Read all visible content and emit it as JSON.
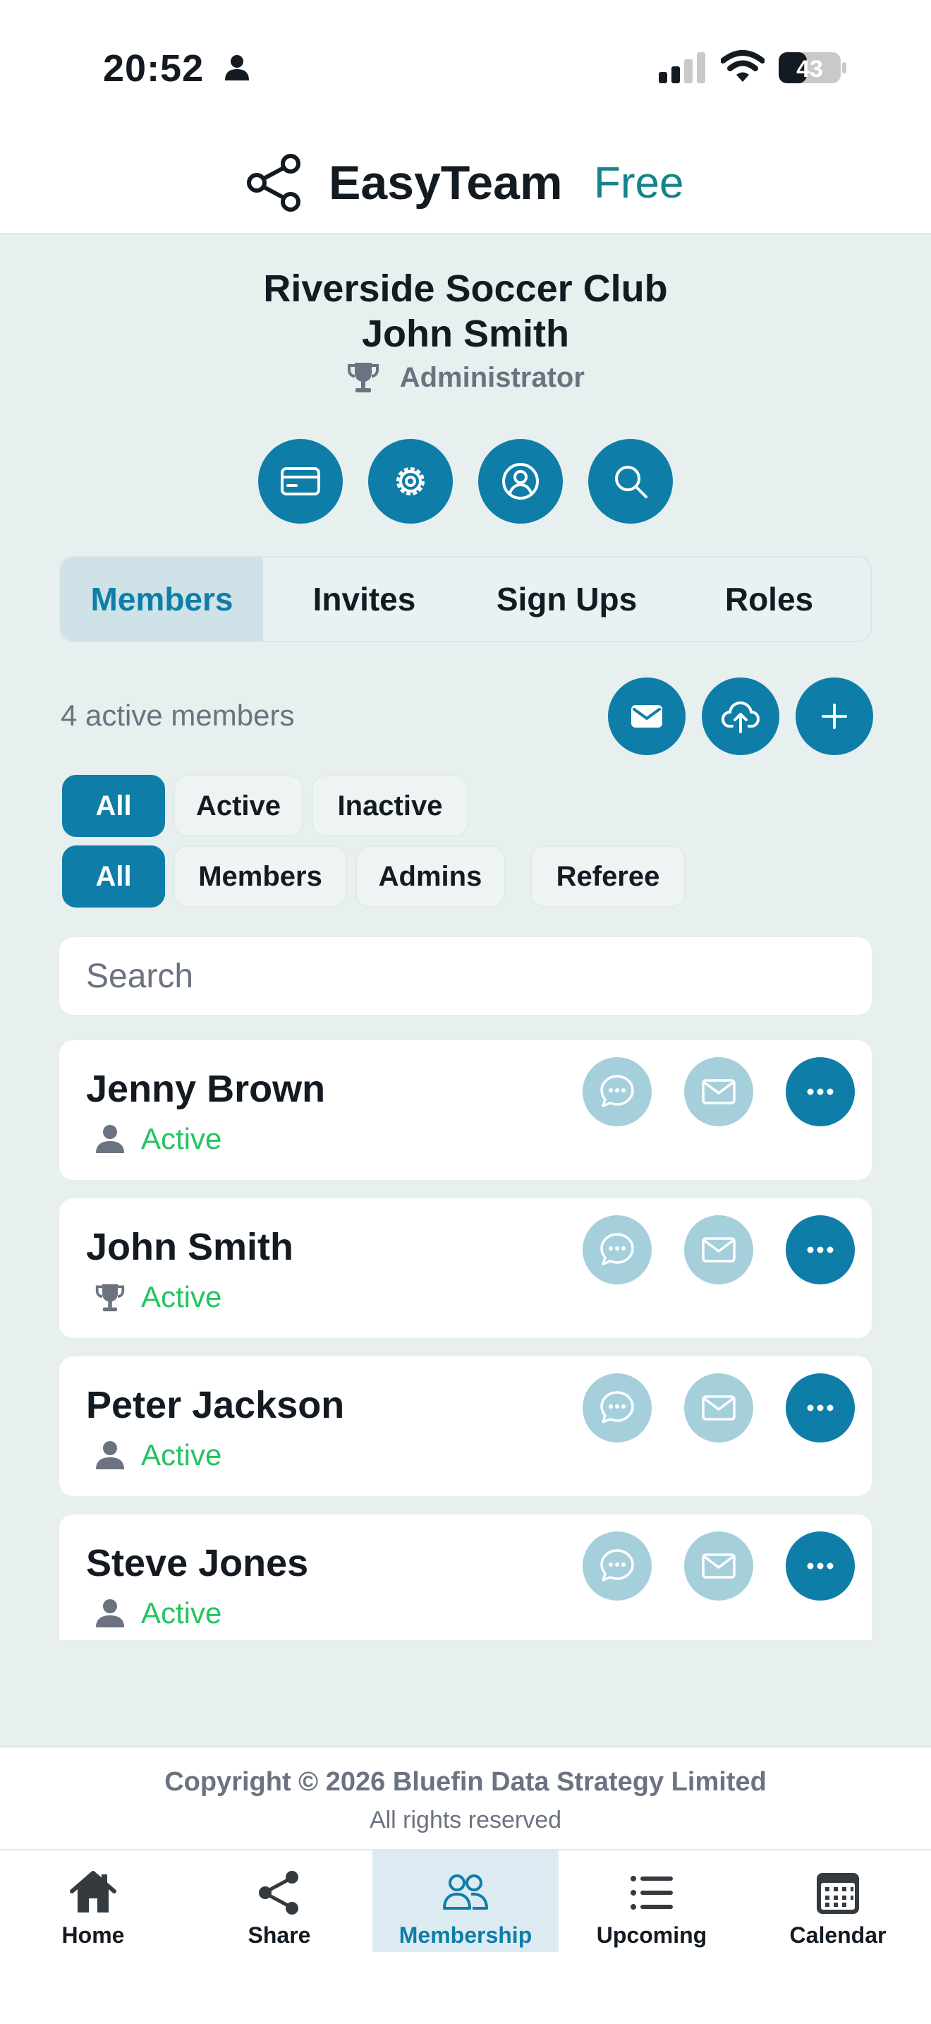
{
  "status_bar": {
    "time": "20:52",
    "battery": "43"
  },
  "header": {
    "app_name": "EasyTeam",
    "plan": "Free"
  },
  "profile": {
    "club": "Riverside Soccer Club",
    "user": "John Smith",
    "role": "Administrator"
  },
  "quick_actions": [
    "card-icon",
    "gear-icon",
    "user-circle-icon",
    "search-icon"
  ],
  "tabs": [
    {
      "label": "Members",
      "active": true
    },
    {
      "label": "Invites",
      "active": false
    },
    {
      "label": "Sign Ups",
      "active": false
    },
    {
      "label": "Roles",
      "active": false
    }
  ],
  "members_summary": "4 active members",
  "list_actions": [
    "mail-icon",
    "cloud-upload-icon",
    "plus-icon"
  ],
  "status_filters": [
    {
      "label": "All",
      "active": true
    },
    {
      "label": "Active",
      "active": false
    },
    {
      "label": "Inactive",
      "active": false
    }
  ],
  "role_filters": [
    {
      "label": "All",
      "active": true
    },
    {
      "label": "Members",
      "active": false
    },
    {
      "label": "Admins",
      "active": false
    },
    {
      "label": "Referee",
      "active": false
    }
  ],
  "search": {
    "placeholder": "Search"
  },
  "members": [
    {
      "name": "Jenny Brown",
      "status": "Active",
      "role_icon": "person-icon"
    },
    {
      "name": "John Smith",
      "status": "Active",
      "role_icon": "trophy-icon"
    },
    {
      "name": "Peter Jackson",
      "status": "Active",
      "role_icon": "person-icon"
    },
    {
      "name": "Steve Jones",
      "status": "Active",
      "role_icon": "person-icon"
    }
  ],
  "footer": {
    "copyright": "Copyright © 2026 Bluefin Data Strategy Limited",
    "rights": "All rights reserved"
  },
  "bottom_nav": [
    {
      "label": "Home",
      "icon": "home-icon",
      "active": false
    },
    {
      "label": "Share",
      "icon": "share-icon",
      "active": false
    },
    {
      "label": "Membership",
      "icon": "users-icon",
      "active": true
    },
    {
      "label": "Upcoming",
      "icon": "list-icon",
      "active": false
    },
    {
      "label": "Calendar",
      "icon": "calendar-icon",
      "active": false
    }
  ],
  "colors": {
    "accent": "#0e7ea8",
    "accent_light": "#a6cfdc",
    "active_status": "#22c55e",
    "brand_free": "#16838a",
    "background": "#e8efef"
  }
}
